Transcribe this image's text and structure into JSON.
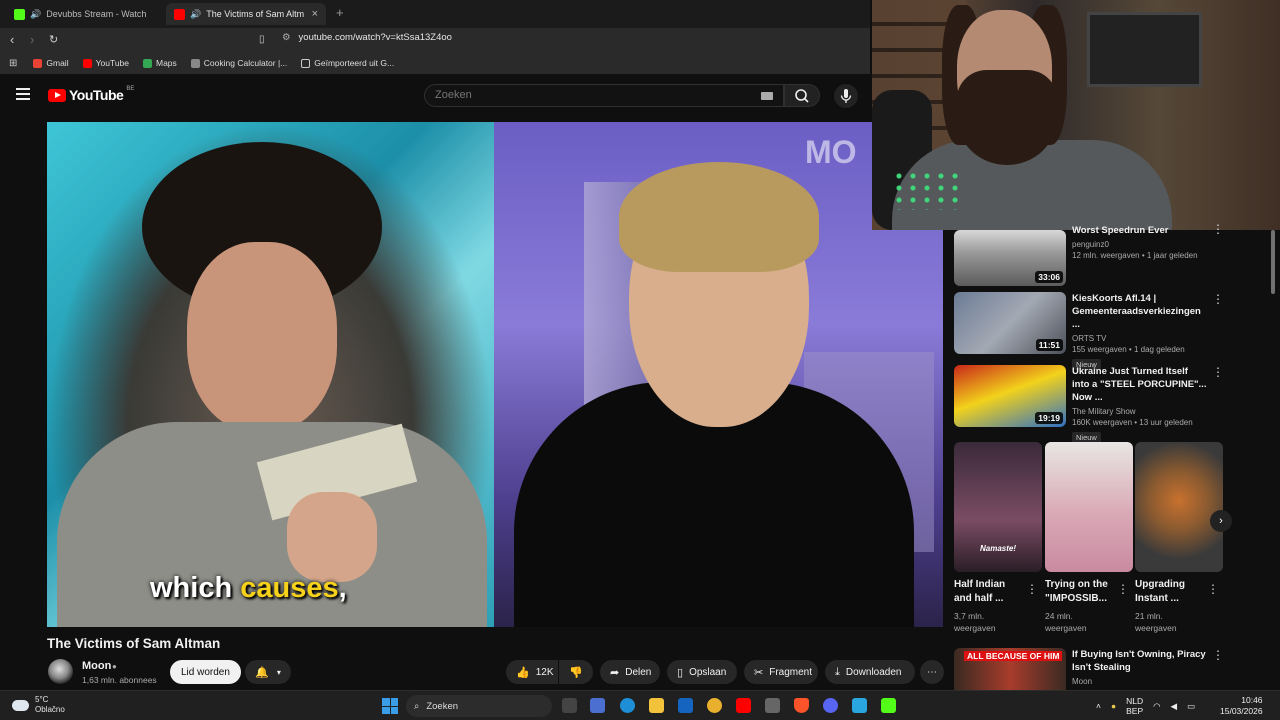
{
  "browser": {
    "tabs": [
      {
        "label": "Devubbs Stream - Watch Live on",
        "active": false
      },
      {
        "label": "The Victims of Sam Altman -",
        "active": true
      }
    ],
    "new_tab": "+",
    "url": "youtube.com/watch?v=ktSsa13Z4oo",
    "bookmarks": [
      {
        "label": "Gmail",
        "icon": "gmail-icon",
        "color": "#ea4335"
      },
      {
        "label": "YouTube",
        "icon": "youtube-icon",
        "color": "#ff0000"
      },
      {
        "label": "Maps",
        "icon": "maps-icon",
        "color": "#34a853"
      },
      {
        "label": "Cooking Calculator |...",
        "icon": "cooking-icon",
        "color": "#888888"
      },
      {
        "label": "Geïmporteerd uit G...",
        "icon": "folder-icon",
        "color": "#cccccc"
      }
    ]
  },
  "youtube": {
    "logo": "YouTube",
    "country_code": "BE",
    "search_placeholder": "Zoeken"
  },
  "video": {
    "brand_overlay": "MO",
    "caption_plain": "which ",
    "caption_highlight": "causes",
    "caption_end": ",",
    "title": "The Victims of Sam Altman",
    "channel": "Moon",
    "subscribers": "1,63 mln. abonnees",
    "join_label": "Lid worden",
    "likes": "12K",
    "share_label": "Delen",
    "save_label": "Opslaan",
    "clip_label": "Fragment",
    "download_label": "Downloaden"
  },
  "recommendations": [
    {
      "title": "Worst Speedrun Ever",
      "channel": "penguinz0",
      "stats": "12 mln. weergaven • 1 jaar geleden",
      "duration": "33:06",
      "badge": ""
    },
    {
      "title": "KiesKoorts Afl.14 | Gemeenteraadsverkiezingen ...",
      "channel": "ORTS TV",
      "stats": "155 weergaven • 1 dag geleden",
      "duration": "11:51",
      "badge": "Nieuw"
    },
    {
      "title": "Ukraine Just Turned Itself into a \"STEEL PORCUPINE\"... Now ...",
      "channel": "The Military Show",
      "stats": "160K weergaven • 13 uur geleden",
      "duration": "19:19",
      "badge": "Nieuw"
    }
  ],
  "shorts": [
    {
      "title": "Half Indian and half ...",
      "views": "3,7 mln. weergaven",
      "overlay": "Namaste!"
    },
    {
      "title": "Trying on the \"IMPOSSIB...",
      "views": "24 mln. weergaven",
      "overlay": ""
    },
    {
      "title": "Upgrading Instant ...",
      "views": "21 mln. weergaven",
      "overlay": ""
    }
  ],
  "bottom_rec": {
    "title": "If Buying Isn't Owning, Piracy Isn't Stealing",
    "channel": "Moon",
    "thumb_text": "ALL BECAUSE OF HIM"
  },
  "taskbar": {
    "temp": "5°C",
    "weather": "Oblačno",
    "search": "Zoeken",
    "lang1": "NLD",
    "lang2": "BEP",
    "time": "10:46",
    "date": "15/03/2026"
  },
  "colors": {
    "accent_red": "#ff0000",
    "caption_yellow": "#f7d21b",
    "background": "#0f0f0f"
  }
}
